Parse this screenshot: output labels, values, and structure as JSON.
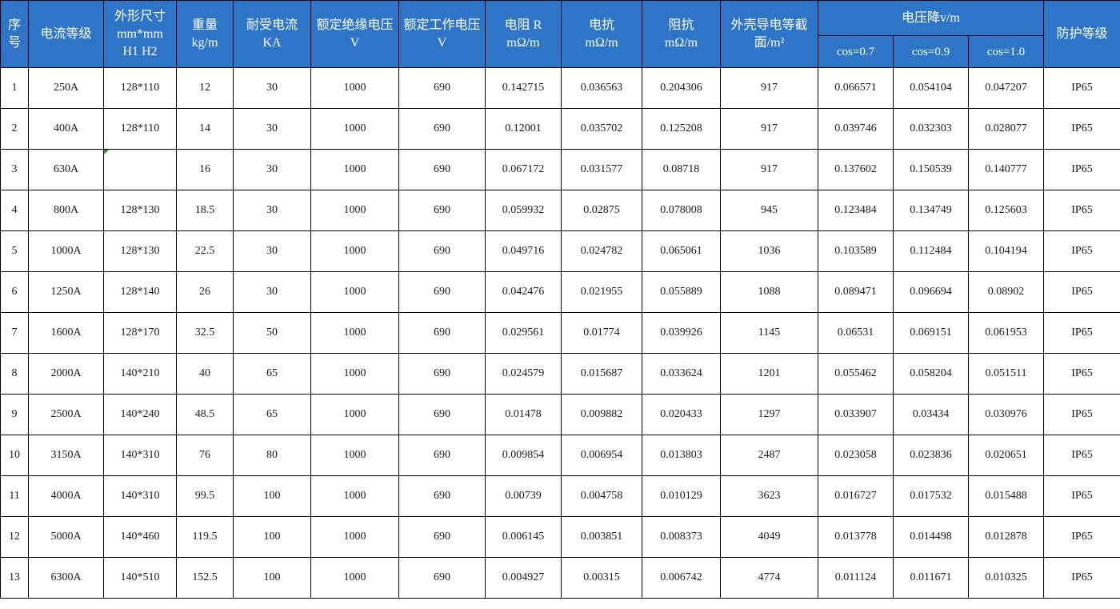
{
  "headers": {
    "index": "序\n号",
    "current_rating": "电流等级",
    "dimensions": "外形尺寸\nmm*mm\nH1 H2",
    "weight": "重量\nkg/m",
    "withstand_current": "耐受电流\nKA",
    "rated_insulation_voltage": "额定绝缘电压\nV",
    "rated_working_voltage": "额定工作电压\nV",
    "resistance": "电阻   R\nmΩ/m",
    "reactance": "电抗\nmΩ/m",
    "impedance": "阻抗\nmΩ/m",
    "shell_section": "外壳导电等截\n面/m²",
    "voltage_drop": "电压降v/m",
    "cos_07": "cos=0.7",
    "cos_09": "cos=0.9",
    "cos_10": "cos=1.0",
    "protection": "防护等级"
  },
  "rows": [
    [
      "1",
      "250A",
      "128*110",
      "12",
      "30",
      "1000",
      "690",
      "0.142715",
      "0.036563",
      "0.204306",
      "917",
      "0.066571",
      "0.054104",
      "0.047207",
      "IP65"
    ],
    [
      "2",
      "400A",
      "128*110",
      "14",
      "30",
      "1000",
      "690",
      "0.12001",
      "0.035702",
      "0.125208",
      "917",
      "0.039746",
      "0.032303",
      "0.028077",
      "IP65"
    ],
    [
      "3",
      "630A",
      "",
      "16",
      "30",
      "1000",
      "690",
      "0.067172",
      "0.031577",
      "0.08718",
      "917",
      "0.137602",
      "0.150539",
      "0.140777",
      "IP65"
    ],
    [
      "4",
      "800A",
      "128*130",
      "18.5",
      "30",
      "1000",
      "690",
      "0.059932",
      "0.02875",
      "0.078008",
      "945",
      "0.123484",
      "0.134749",
      "0.125603",
      "IP65"
    ],
    [
      "5",
      "1000A",
      "128*130",
      "22.5",
      "30",
      "1000",
      "690",
      "0.049716",
      "0.024782",
      "0.065061",
      "1036",
      "0.103589",
      "0.112484",
      "0.104194",
      "IP65"
    ],
    [
      "6",
      "1250A",
      "128*140",
      "26",
      "30",
      "1000",
      "690",
      "0.042476",
      "0.021955",
      "0.055889",
      "1088",
      "0.089471",
      "0.096694",
      "0.08902",
      "IP65"
    ],
    [
      "7",
      "1600A",
      "128*170",
      "32.5",
      "50",
      "1000",
      "690",
      "0.029561",
      "0.01774",
      "0.039926",
      "1145",
      "0.06531",
      "0.069151",
      "0.061953",
      "IP65"
    ],
    [
      "8",
      "2000A",
      "140*210",
      "40",
      "65",
      "1000",
      "690",
      "0.024579",
      "0.015687",
      "0.033624",
      "1201",
      "0.055462",
      "0.058204",
      "0.051511",
      "IP65"
    ],
    [
      "9",
      "2500A",
      "140*240",
      "48.5",
      "65",
      "1000",
      "690",
      "0.01478",
      "0.009882",
      "0.020433",
      "1297",
      "0.033907",
      "0.03434",
      "0.030976",
      "IP65"
    ],
    [
      "10",
      "3150A",
      "140*310",
      "76",
      "80",
      "1000",
      "690",
      "0.009854",
      "0.006954",
      "0.013803",
      "2487",
      "0.023058",
      "0.023836",
      "0.020651",
      "IP65"
    ],
    [
      "11",
      "4000A",
      "140*310",
      "99.5",
      "100",
      "1000",
      "690",
      "0.00739",
      "0.004758",
      "0.010129",
      "3623",
      "0.016727",
      "0.017532",
      "0.015488",
      "IP65"
    ],
    [
      "12",
      "5000A",
      "140*460",
      "119.5",
      "100",
      "1000",
      "690",
      "0.006145",
      "0.003851",
      "0.008373",
      "4049",
      "0.013778",
      "0.014498",
      "0.012878",
      "IP65"
    ],
    [
      "13",
      "6300A",
      "140*510",
      "152.5",
      "100",
      "1000",
      "690",
      "0.004927",
      "0.00315",
      "0.006742",
      "4774",
      "0.011124",
      "0.011671",
      "0.010325",
      "IP65"
    ]
  ],
  "colors": {
    "header_bg": "#2e75c8",
    "header_text": "#ffffff",
    "grid_line": "#000000",
    "cell_flag": "#1e8c3a"
  }
}
